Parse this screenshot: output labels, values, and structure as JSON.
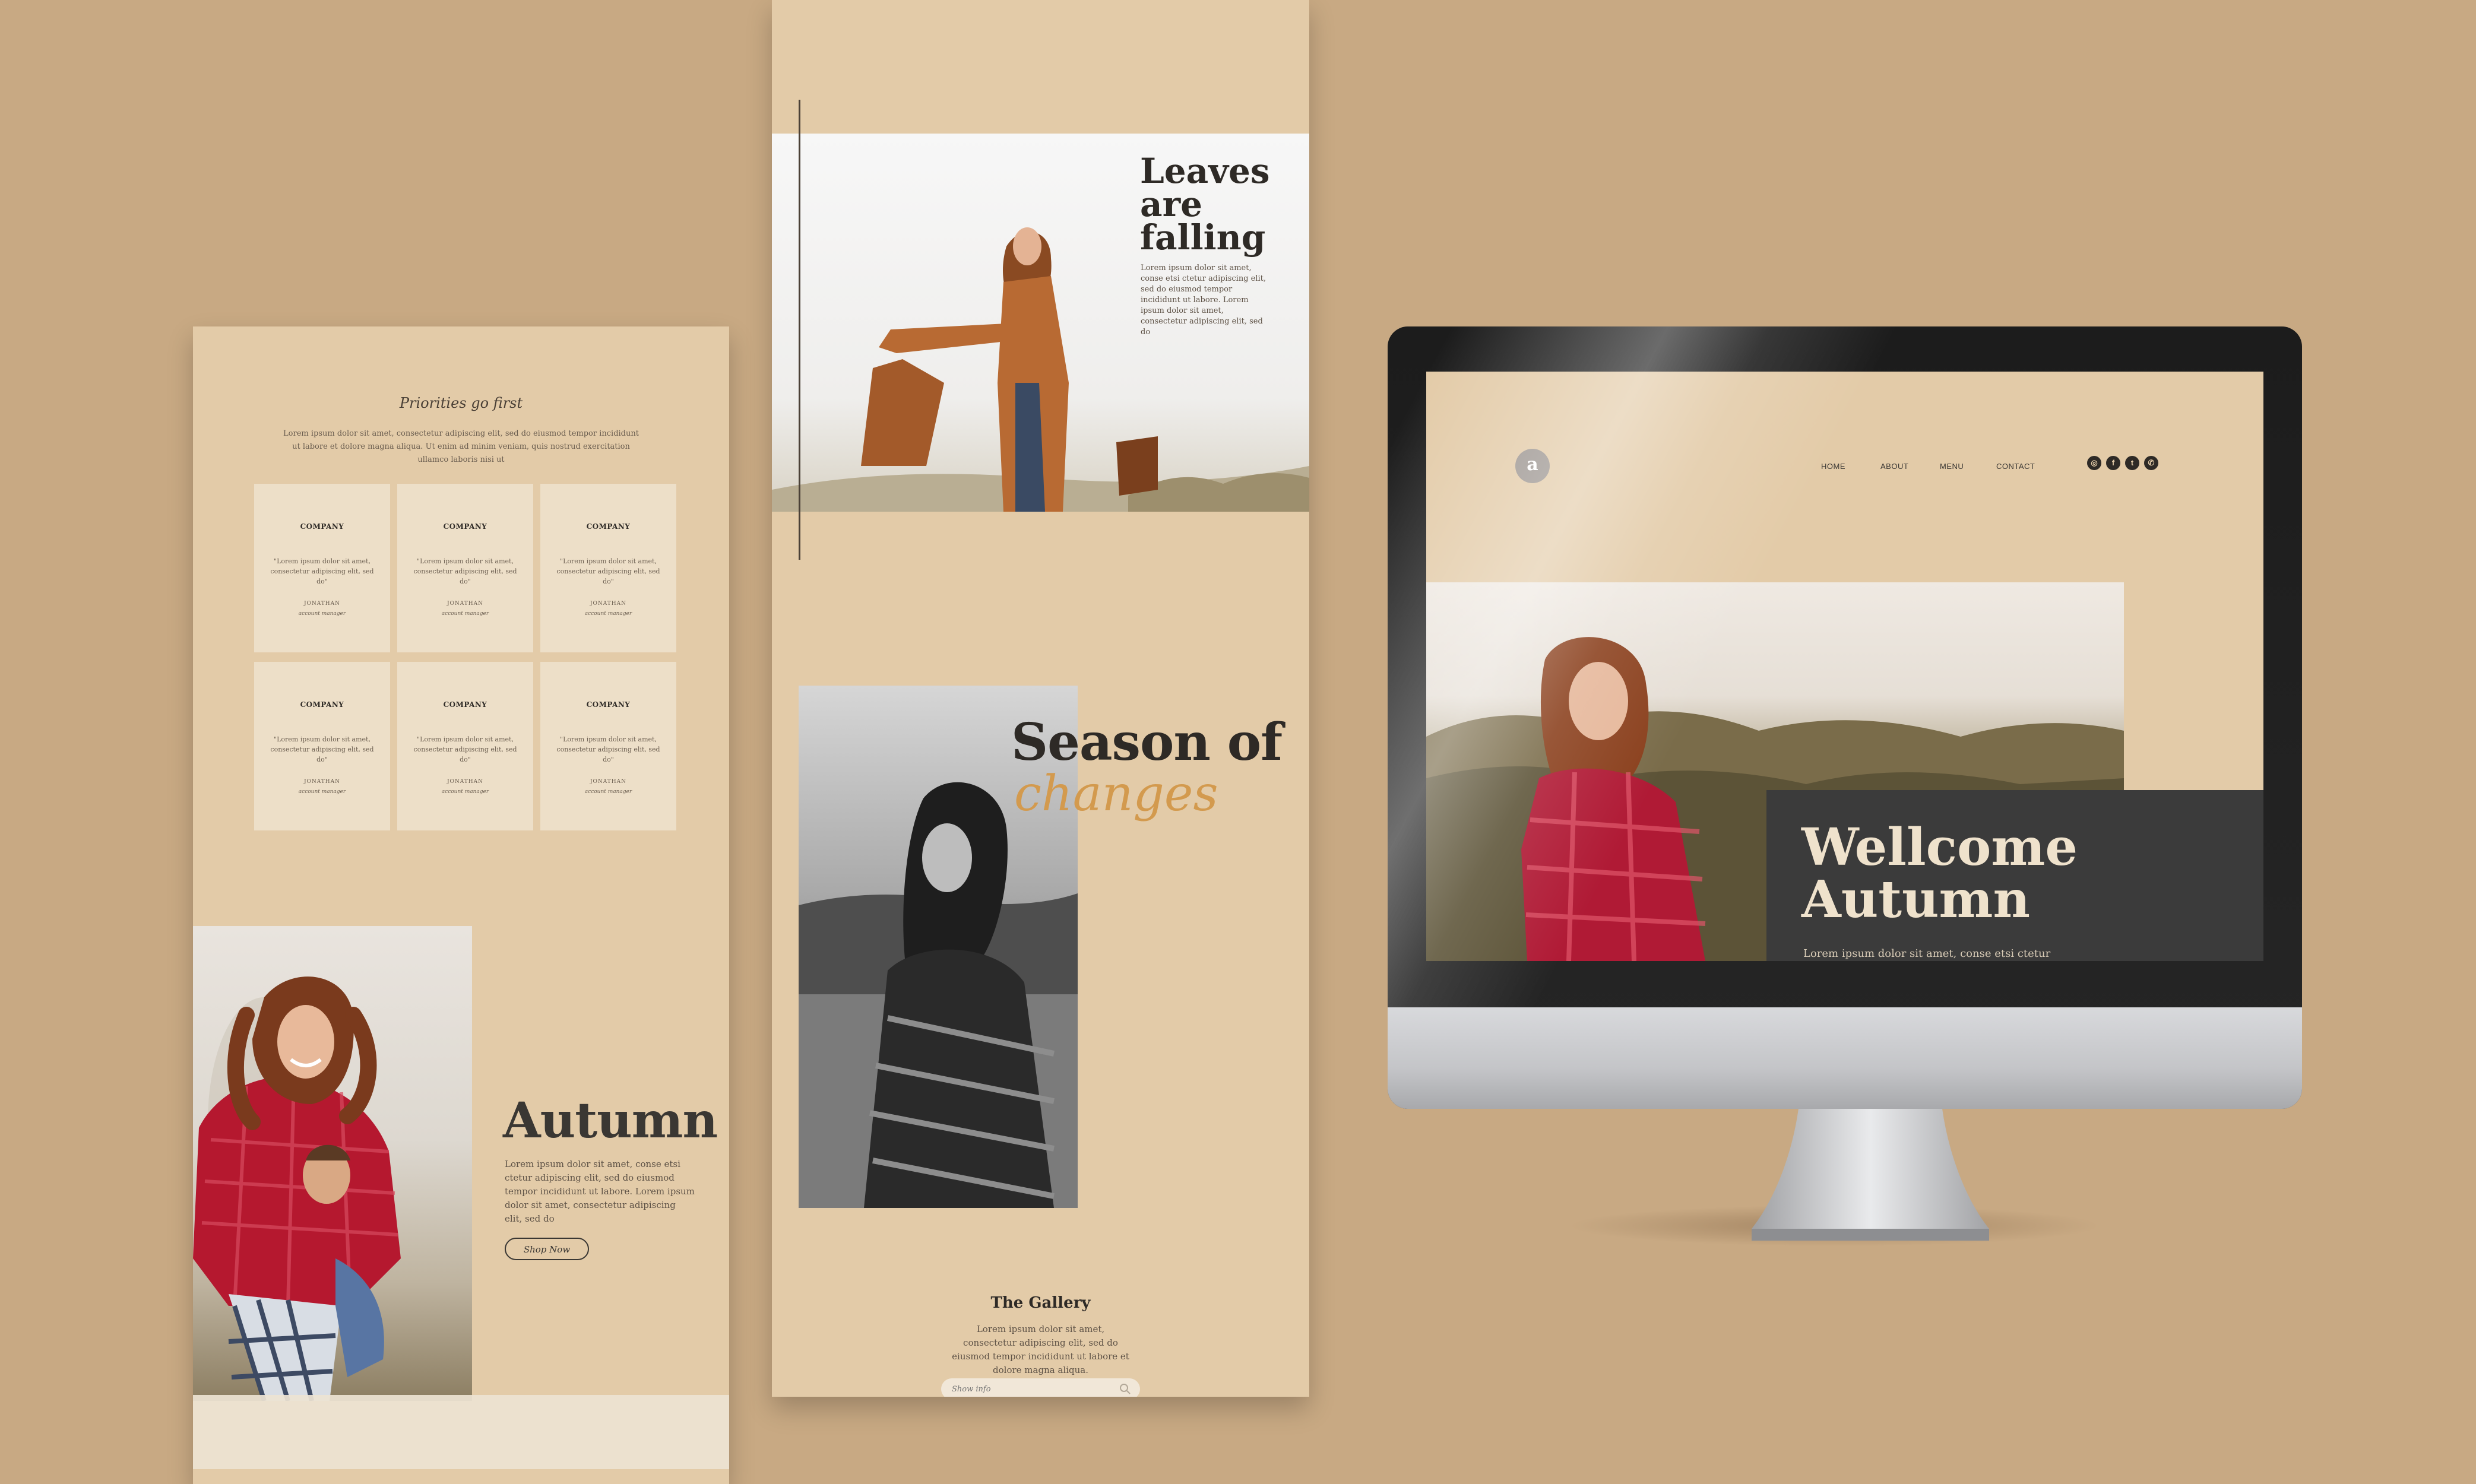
{
  "left_panel": {
    "heading": "Priorities go first",
    "intro": "Lorem ipsum dolor sit amet, consectetur adipiscing elit, sed do eiusmod tempor incididunt ut labore et dolore magna aliqua. Ut enim ad minim veniam, quis nostrud exercitation ullamco laboris nisi ut",
    "testimonials": [
      {
        "company": "COMPANY",
        "quote": "\"Lorem ipsum dolor sit amet, consectetur adipiscing elit, sed do\"",
        "person": "JONATHAN",
        "role": "account manager"
      },
      {
        "company": "COMPANY",
        "quote": "\"Lorem ipsum dolor sit amet, consectetur adipiscing elit, sed do\"",
        "person": "JONATHAN",
        "role": "account manager"
      },
      {
        "company": "COMPANY",
        "quote": "\"Lorem ipsum dolor sit amet, consectetur adipiscing elit, sed do\"",
        "person": "JONATHAN",
        "role": "account manager"
      },
      {
        "company": "COMPANY",
        "quote": "\"Lorem ipsum dolor sit amet, consectetur adipiscing elit, sed do\"",
        "person": "JONATHAN",
        "role": "account manager"
      },
      {
        "company": "COMPANY",
        "quote": "\"Lorem ipsum dolor sit amet, consectetur adipiscing elit, sed do\"",
        "person": "JONATHAN",
        "role": "account manager"
      },
      {
        "company": "COMPANY",
        "quote": "\"Lorem ipsum dolor sit amet, consectetur adipiscing elit, sed do\"",
        "person": "JONATHAN",
        "role": "account manager"
      }
    ],
    "autumn_title": "Autumn",
    "autumn_body": "Lorem ipsum dolor sit amet, conse etsi ctetur adipiscing elit, sed do eiusmod tempor incididunt ut labore. Lorem ipsum dolor sit amet, consectetur adipiscing elit, sed do",
    "shop_button": "Shop Now"
  },
  "middle_panel": {
    "hero_title_line1": "Leaves",
    "hero_title_line2": "are",
    "hero_title_line3": "falling",
    "hero_body": "Lorem ipsum dolor sit amet, conse etsi ctetur adipiscing elit, sed do eiusmod tempor incididunt ut labore. Lorem ipsum dolor sit amet, consectetur adipiscing elit, sed do",
    "season_line1": "Season of",
    "season_line2": "changes",
    "gallery_title": "The Gallery",
    "gallery_body": "Lorem ipsum dolor sit amet, consectetur adipiscing elit, sed do eiusmod tempor incididunt ut labore et dolore magna aliqua.",
    "search_placeholder": "Show info"
  },
  "monitor": {
    "logo_letter": "a",
    "nav": [
      "HOME",
      "ABOUT",
      "MENU",
      "CONTACT"
    ],
    "social_icons": [
      "instagram-icon",
      "facebook-icon",
      "twitter-icon",
      "whatsapp-icon"
    ],
    "welcome_line1": "Wellcome",
    "welcome_line2": "Autumn",
    "welcome_body": "Lorem ipsum dolor sit amet, conse etsi ctetur"
  },
  "colors": {
    "background": "#c8a983",
    "panel_beige": "#e3cba8",
    "card": "#eddfc8",
    "accent_orange": "#d39a4e",
    "dark_text": "#2e2a26",
    "dark_box": "#3b3b3b"
  }
}
